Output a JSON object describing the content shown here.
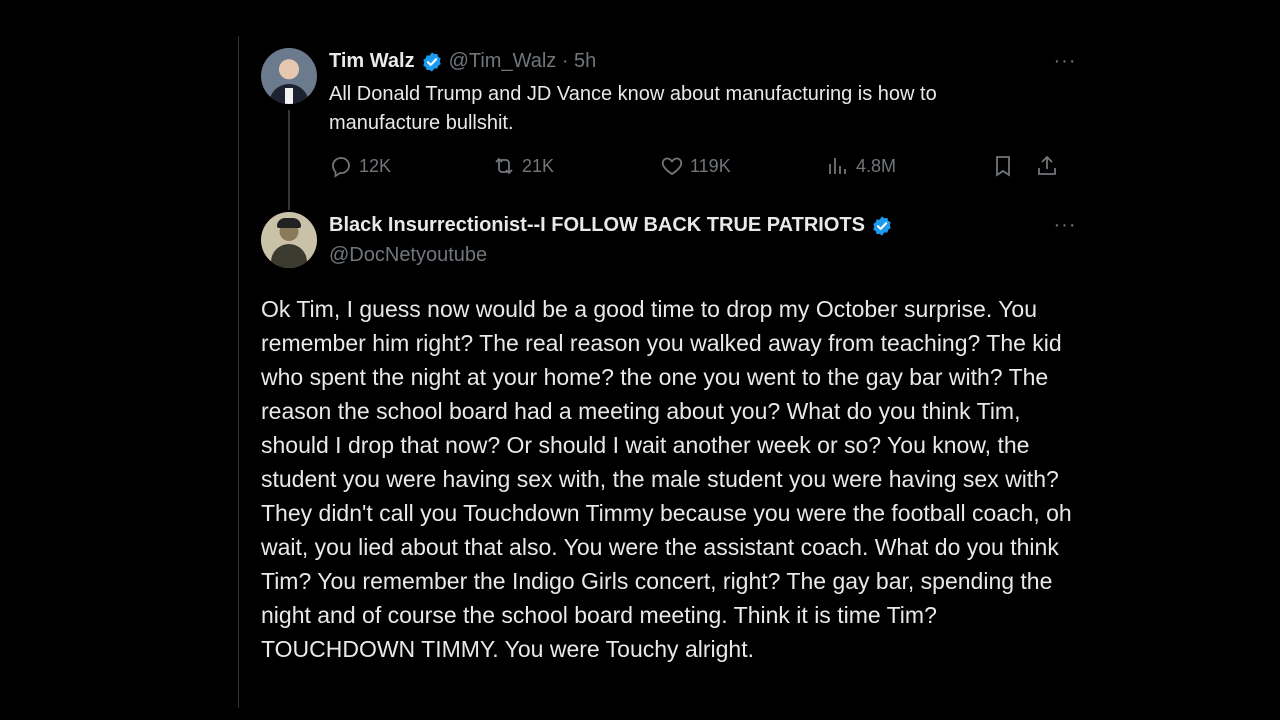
{
  "tweet1": {
    "name": "Tim Walz",
    "handle": "@Tim_Walz · 5h",
    "text": "All Donald Trump and JD Vance know about manufacturing is how to manufacture bullshit.",
    "replies": "12K",
    "reposts": "21K",
    "likes": "119K",
    "views": "4.8M",
    "more": "···"
  },
  "tweet2": {
    "name": "Black Insurrectionist--I FOLLOW BACK TRUE PATRIOTS",
    "handle": "@DocNetyoutube",
    "more": "···",
    "text": "Ok Tim, I guess now would be a good time to drop my October surprise. You remember him right? The real reason you walked away from teaching? The kid who spent the night at your home? the one you went to the gay bar with? The reason the school board had a meeting about you? What do you think Tim, should I drop that now? Or should I wait another week or so? You know, the student you were having sex with, the male student you were having sex with? They didn't call you Touchdown Timmy because you were the football coach, oh wait, you lied about that also. You were the assistant coach. What do you think Tim? You remember the Indigo Girls concert, right? The gay bar, spending the night and of course the school board meeting. Think it is time Tim? TOUCHDOWN TIMMY. You were Touchy alright."
  },
  "colors": {
    "background": "#000000",
    "text": "#e7e9ea",
    "muted": "#71767b",
    "verified": "#1d9bf0"
  },
  "icons": [
    "reply-icon",
    "repost-icon",
    "like-icon",
    "views-icon",
    "bookmark-icon",
    "share-icon",
    "verified-badge-icon",
    "more-icon"
  ]
}
